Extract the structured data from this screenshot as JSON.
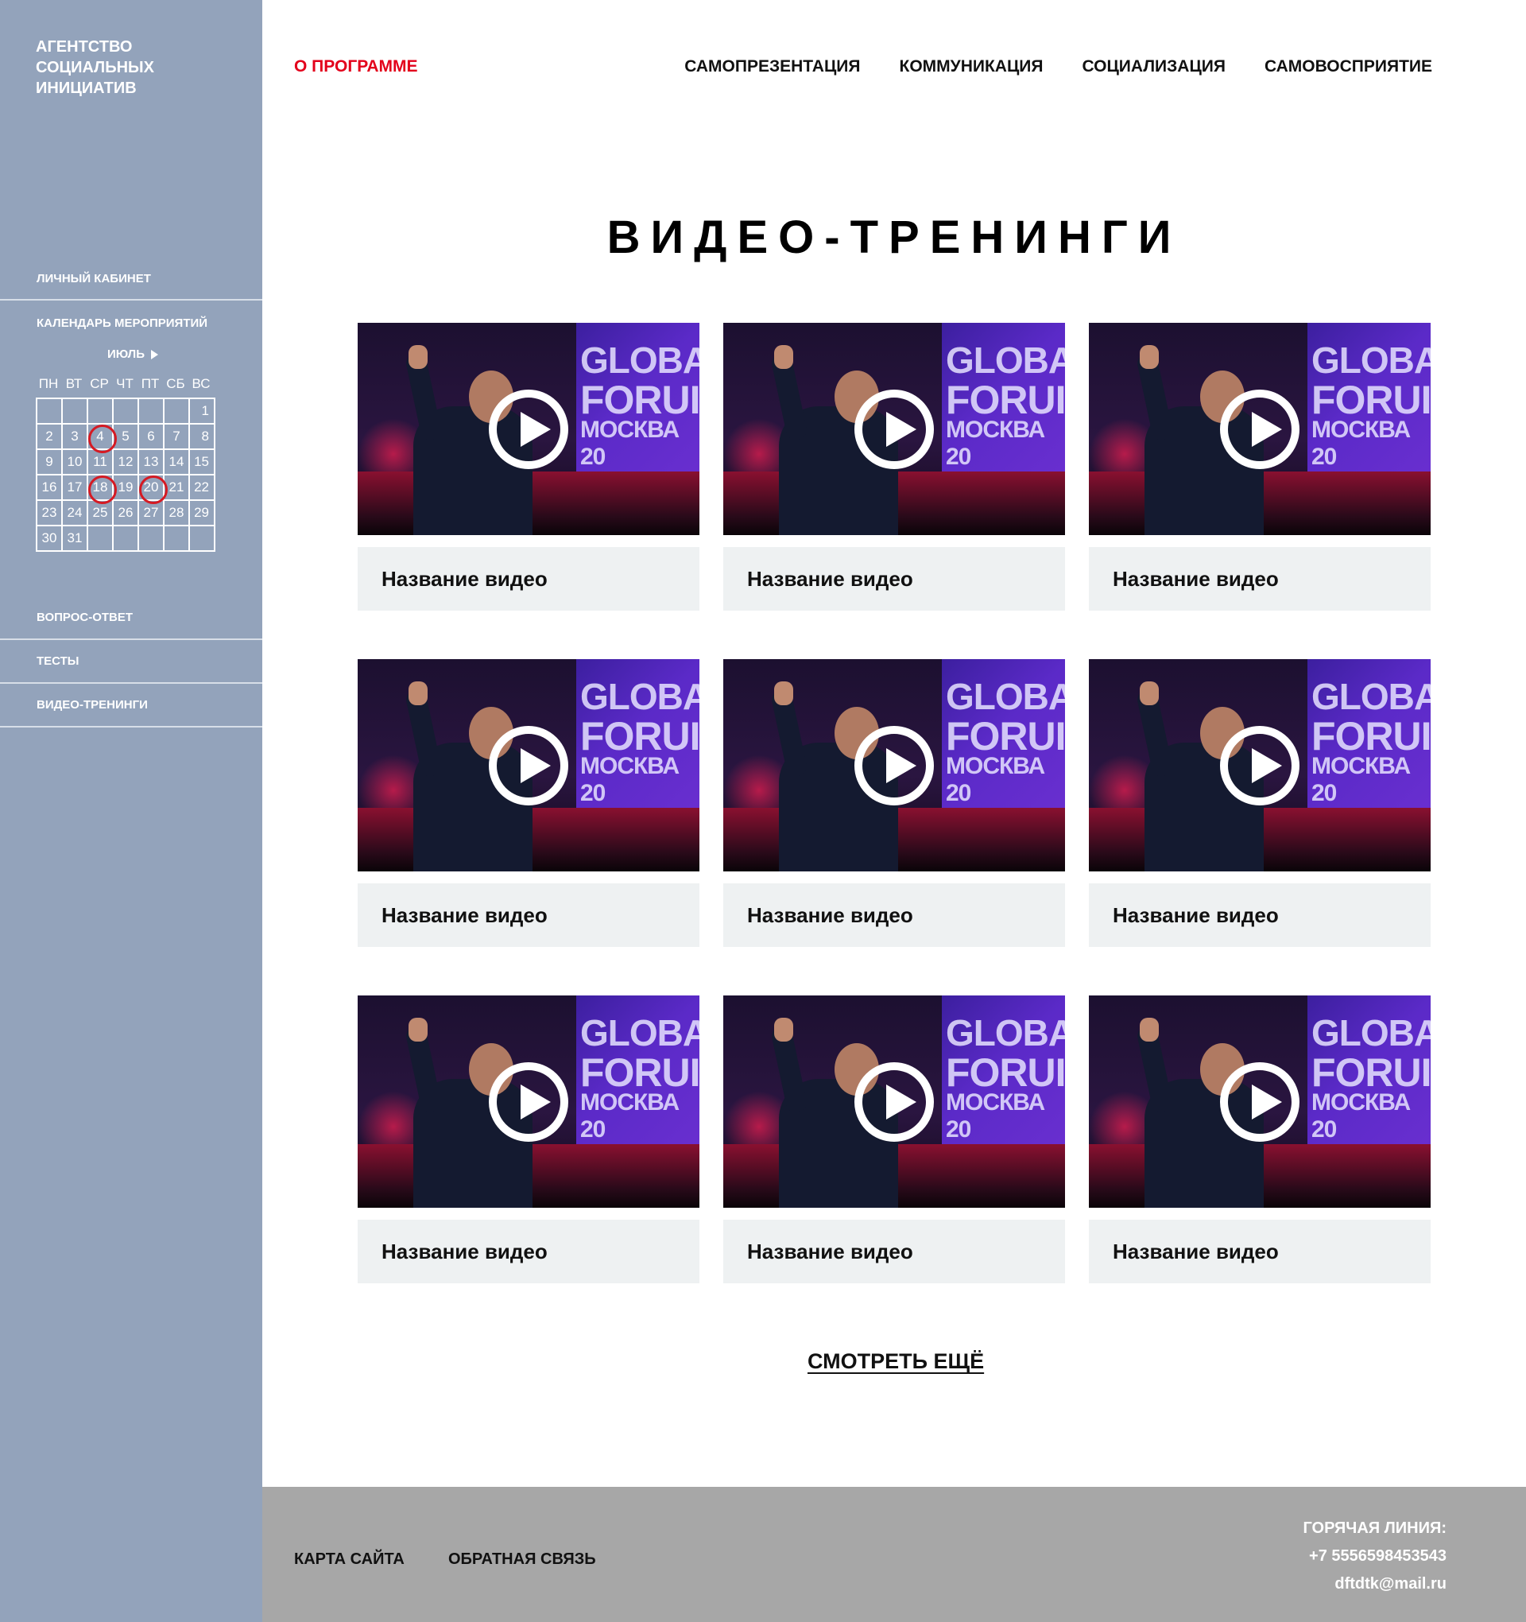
{
  "sidebar": {
    "logo_lines": [
      "АГЕНТСТВО",
      "СОЦИАЛЬНЫХ",
      "ИНИЦИАТИВ"
    ],
    "cabinet": "ЛИЧНЫЙ КАБИНЕТ",
    "calendar": {
      "title": "КАЛЕНДАРЬ МЕРОПРИЯТИЙ",
      "month": "ИЮЛЬ",
      "weekdays": [
        "ПН",
        "ВТ",
        "СР",
        "ЧТ",
        "ПТ",
        "СБ",
        "ВС"
      ],
      "weeks": [
        [
          "",
          "",
          "",
          "",
          "",
          "",
          "1"
        ],
        [
          "2",
          "3",
          "4",
          "5",
          "6",
          "7",
          "8"
        ],
        [
          "9",
          "10",
          "11",
          "12",
          "13",
          "14",
          "15"
        ],
        [
          "16",
          "17",
          "18",
          "19",
          "20",
          "21",
          "22"
        ],
        [
          "23",
          "24",
          "25",
          "26",
          "27",
          "28",
          "29"
        ],
        [
          "30",
          "31",
          "",
          "",
          "",
          "",
          ""
        ]
      ],
      "marked_days": [
        "4",
        "18",
        "20"
      ],
      "marker_color": "#d51a23"
    },
    "links": [
      "ВОПРОС-ОТВЕТ",
      "ТЕСТЫ",
      "ВИДЕО-ТРЕНИНГИ"
    ]
  },
  "header": {
    "about": "О ПРОГРАММЕ",
    "nav": [
      "САМОПРЕЗЕНТАЦИЯ",
      "КОММУНИКАЦИЯ",
      "СОЦИАЛИЗАЦИЯ",
      "САМОВОСПРИЯТИЕ"
    ]
  },
  "main": {
    "title": "ВИДЕО-ТРЕНИНГИ",
    "thumb_text": [
      "GLOBA",
      "FORUI",
      "МОСКВА 20"
    ],
    "videos": [
      {
        "title": "Название видео"
      },
      {
        "title": "Название видео"
      },
      {
        "title": "Название видео"
      },
      {
        "title": "Название видео"
      },
      {
        "title": "Название видео"
      },
      {
        "title": "Название видео"
      },
      {
        "title": "Название видео"
      },
      {
        "title": "Название видео"
      },
      {
        "title": "Название видео"
      }
    ],
    "more": "СМОТРЕТЬ ЕЩЁ"
  },
  "footer": {
    "sitemap": "КАРТА САЙТА",
    "feedback": "ОБРАТНАЯ СВЯЗЬ",
    "hotline_label": "ГОРЯЧАЯ ЛИНИЯ:",
    "phone": "+7 5556598453543",
    "email": "dftdtk@mail.ru"
  },
  "colors": {
    "sidebar_bg": "#93a3bb",
    "accent_red": "#e3001b",
    "caption_bg": "#eef1f2",
    "footer_bg": "#a7a7a7"
  }
}
